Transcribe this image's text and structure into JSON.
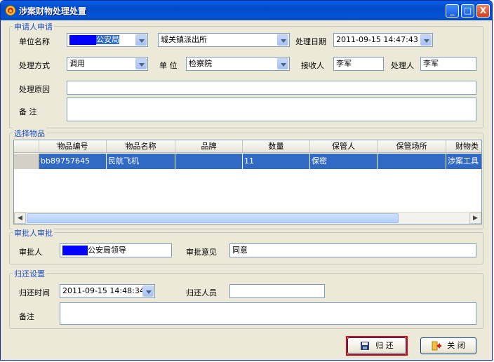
{
  "window": {
    "title": "涉案财物处理处置",
    "controls": {
      "minimize": "_",
      "maximize": "□",
      "close": "X"
    }
  },
  "applicant": {
    "section_title": "申请人申请",
    "unit_name_label": "单位名称",
    "unit_name_value": "公安局",
    "unit_name_sub_value": "城关镇派出所",
    "process_date_label": "处理日期",
    "process_date_value": "2011-09-15 14:47:43",
    "method_label": "处理方式",
    "method_value": "调用",
    "unit_label": "单 位",
    "unit_value": "检察院",
    "receiver_label": "接收人",
    "receiver_value": "李军",
    "handler_label": "处理人",
    "handler_value": "李军",
    "reason_label": "处理原因",
    "reason_value": "",
    "remark_label": "备 注",
    "remark_value": ""
  },
  "items": {
    "section_title": "选择物品",
    "columns": [
      "物品编号",
      "物品名称",
      "品牌",
      "数量",
      "保管人",
      "保管场所",
      "财物类"
    ],
    "rows": [
      [
        "bb89757645",
        "民航飞机",
        "",
        "11",
        "保密",
        "",
        "涉案工具"
      ]
    ]
  },
  "approval": {
    "section_title": "审批人审批",
    "approver_label": "审批人",
    "approver_value": "公安局领导",
    "opinion_label": "审批意见",
    "opinion_value": "同意"
  },
  "return": {
    "section_title": "归还设置",
    "time_label": "归还时间",
    "time_value": "2011-09-15 14:48:34",
    "person_label": "归还人员",
    "person_value": "",
    "remark_label": "备注",
    "remark_value": ""
  },
  "buttons": {
    "return_label": "归 还",
    "close_label": "关 闭"
  },
  "colors": {
    "titlebar": "#0348c8",
    "section_title": "#1e4ec8",
    "selection": "#316ac5",
    "redaction": "#0000ff",
    "focus_border": "#e8000c"
  }
}
